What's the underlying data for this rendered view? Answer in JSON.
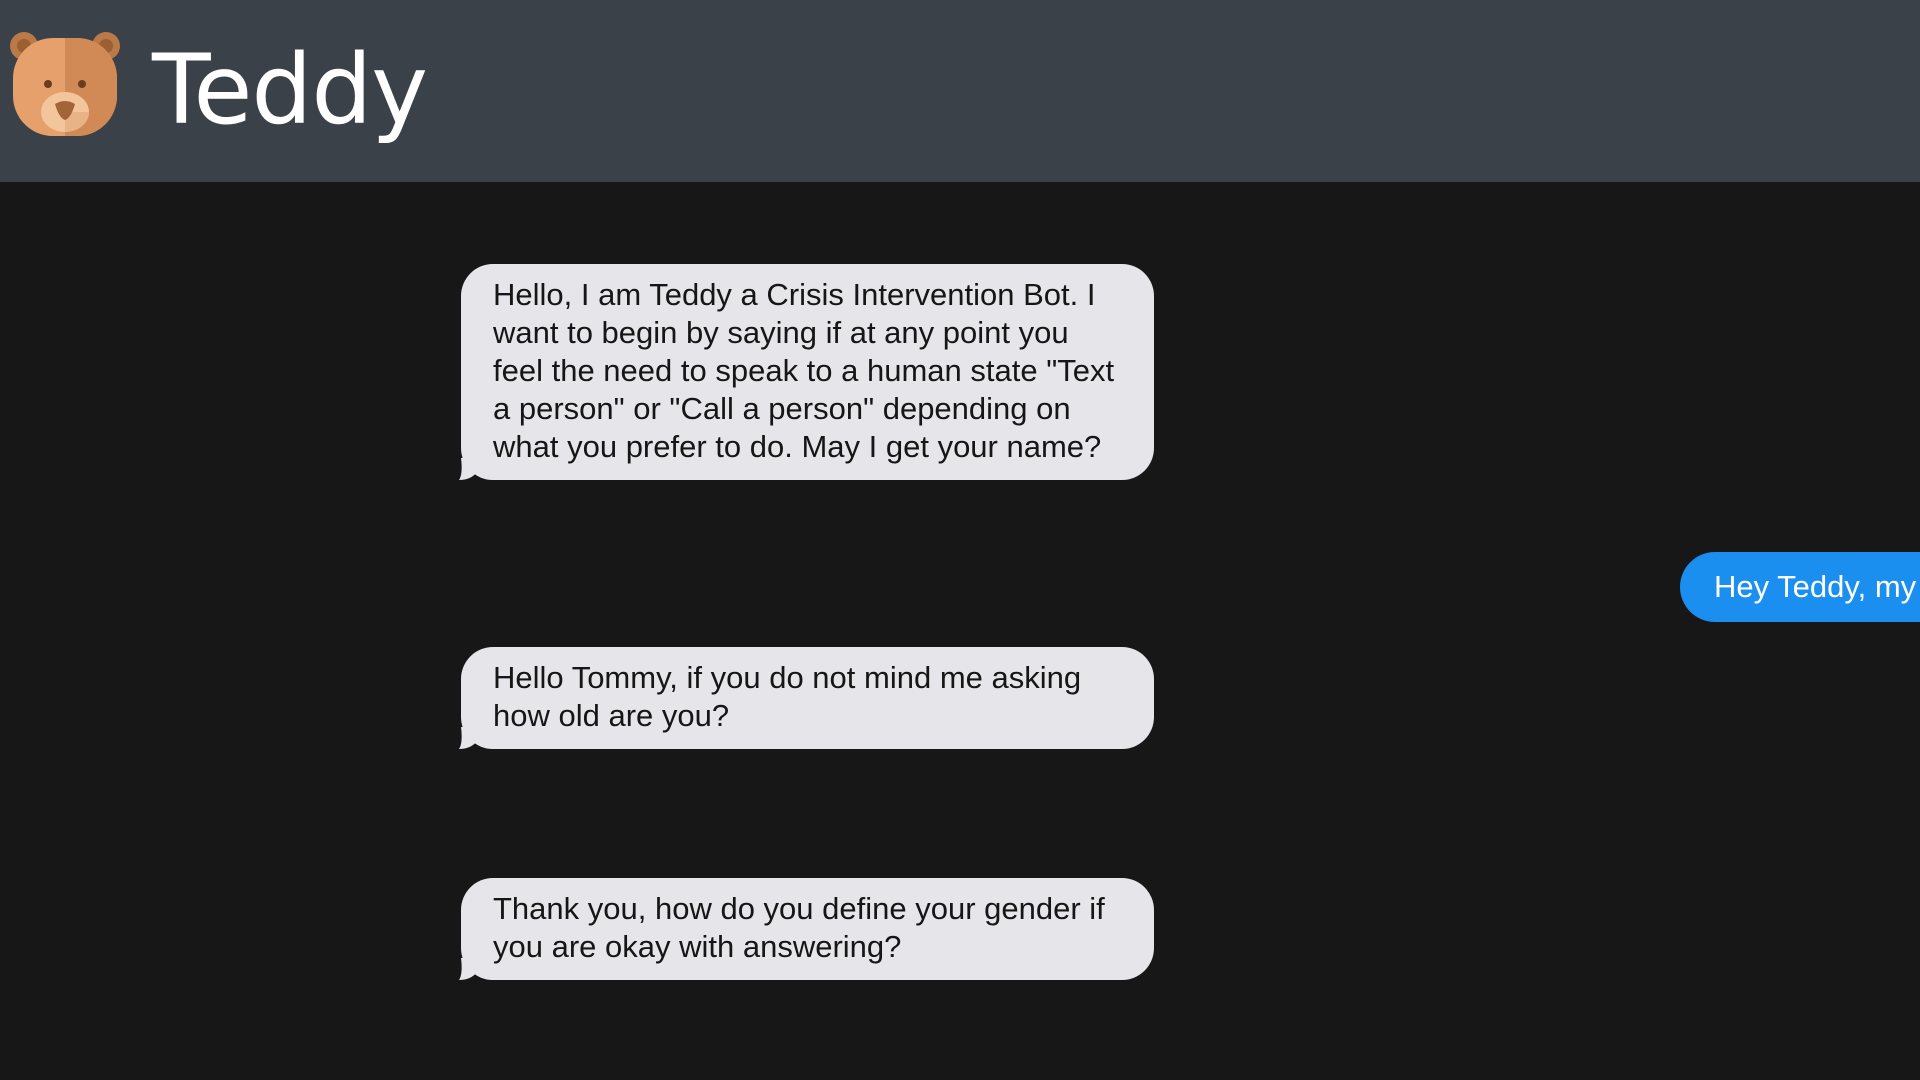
{
  "header": {
    "title": "Teddy",
    "logo_icon": "teddy-bear-icon",
    "background": "#3b4148"
  },
  "chat": {
    "background": "#171718",
    "messages": [
      {
        "sender": "bot",
        "text": "Hello, I am Teddy a Crisis Intervention Bot. I want to begin by saying if at any point you feel the need to speak to a human state \"Text a person\" or \"Call a person\" depending on what you prefer to do. May I get your name?"
      },
      {
        "sender": "user",
        "text": "Hey Teddy, my"
      },
      {
        "sender": "bot",
        "text": "Hello Tommy, if you do not mind me asking how old are you?"
      },
      {
        "sender": "bot",
        "text": "Thank you, how do you define your gender if you are okay with answering?"
      }
    ]
  },
  "colors": {
    "bot_bubble": "#e6e5ea",
    "user_bubble": "#1a8ff0"
  }
}
